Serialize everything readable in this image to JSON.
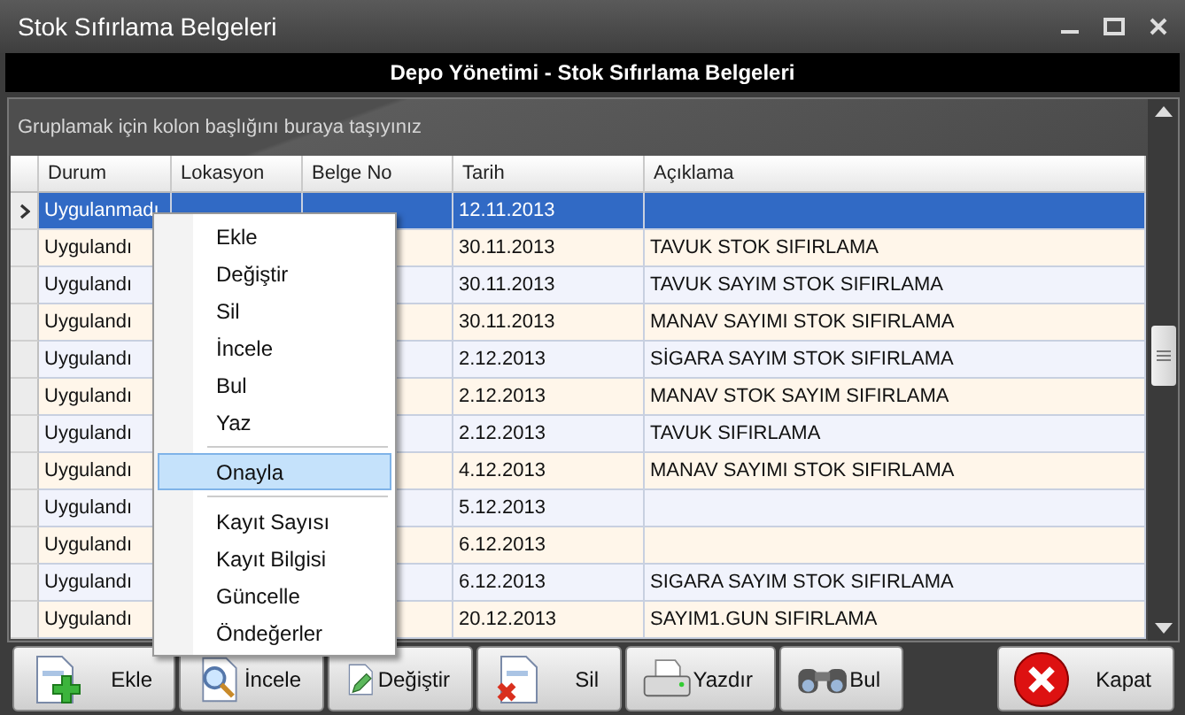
{
  "window": {
    "title": "Stok Sıfırlama Belgeleri"
  },
  "header": "Depo Yönetimi - Stok Sıfırlama Belgeleri",
  "group_panel": {
    "hint": "Gruplamak için kolon başlığını buraya taşıyınız"
  },
  "table": {
    "columns": [
      "Durum",
      "Lokasyon",
      "Belge No",
      "Tarih",
      "Açıklama"
    ],
    "rows": [
      {
        "durum": "Uygulanmadı",
        "tarih": "12.11.2013",
        "selected": true
      },
      {
        "durum": "Uygulandı",
        "tarih": "30.11.2013",
        "aciklama": "TAVUK STOK SIFIRLAMA",
        "selected": false
      },
      {
        "durum": "Uygulandı",
        "tarih": "30.11.2013",
        "aciklama": "TAVUK SAYIM STOK SIFIRLAMA",
        "selected": false
      },
      {
        "durum": "Uygulandı",
        "tarih": "30.11.2013",
        "aciklama": "MANAV SAYIMI STOK SIFIRLAMA",
        "selected": false
      },
      {
        "durum": "Uygulandı",
        "tarih": "2.12.2013",
        "aciklama": "SİGARA SAYIM STOK SIFIRLAMA",
        "selected": false
      },
      {
        "durum": "Uygulandı",
        "tarih": "2.12.2013",
        "aciklama": "MANAV STOK SAYIM SIFIRLAMA",
        "selected": false
      },
      {
        "durum": "Uygulandı",
        "tarih": "2.12.2013",
        "aciklama": "TAVUK SIFIRLAMA",
        "selected": false
      },
      {
        "durum": "Uygulandı",
        "tarih": "4.12.2013",
        "aciklama": "MANAV SAYIMI STOK SIFIRLAMA",
        "selected": false
      },
      {
        "durum": "Uygulandı",
        "tarih": "5.12.2013",
        "selected": false
      },
      {
        "durum": "Uygulandı",
        "tarih": "6.12.2013",
        "selected": false
      },
      {
        "durum": "Uygulandı",
        "tarih": "6.12.2013",
        "aciklama": "SIGARA SAYIM STOK SIFIRLAMA",
        "selected": false
      },
      {
        "durum": "Uygulandı",
        "tarih": "20.12.2013",
        "aciklama": "SAYIM1.GUN SIFIRLAMA",
        "selected": false
      }
    ]
  },
  "context_menu": [
    {
      "kind": "item",
      "label": "Ekle",
      "selected": false
    },
    {
      "kind": "item",
      "label": "Değiştir",
      "selected": false
    },
    {
      "kind": "item",
      "label": "Sil",
      "selected": false
    },
    {
      "kind": "item",
      "label": "İncele",
      "selected": false
    },
    {
      "kind": "item",
      "label": "Bul",
      "selected": false
    },
    {
      "kind": "item",
      "label": "Yaz",
      "selected": false
    },
    {
      "kind": "separator"
    },
    {
      "kind": "item",
      "label": "Onayla",
      "selected": true
    },
    {
      "kind": "separator"
    },
    {
      "kind": "item",
      "label": "Kayıt Sayısı",
      "selected": false
    },
    {
      "kind": "item",
      "label": "Kayıt Bilgisi",
      "selected": false
    },
    {
      "kind": "item",
      "label": "Güncelle",
      "selected": false
    },
    {
      "kind": "item",
      "label": "Öndeğerler",
      "selected": false
    }
  ],
  "toolbar": [
    {
      "kind": "add",
      "label": "Ekle"
    },
    {
      "kind": "view",
      "label": "İncele"
    },
    {
      "kind": "edit",
      "label": "Değiştir"
    },
    {
      "kind": "delete",
      "label": "Sil"
    },
    {
      "kind": "print",
      "label": "Yazdır"
    },
    {
      "kind": "find",
      "label": "Bul"
    },
    {
      "kind": "close",
      "label": "Kapat"
    }
  ]
}
